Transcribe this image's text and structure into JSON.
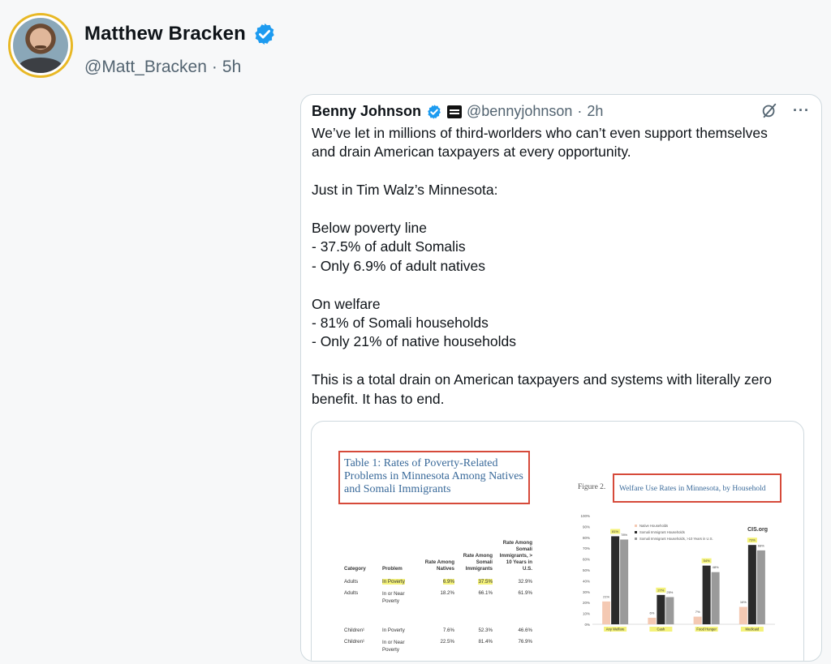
{
  "author": {
    "display_name": "Matthew Bracken",
    "handle": "@Matt_Bracken",
    "separator": "·",
    "time": "5h"
  },
  "quote": {
    "display_name": "Benny Johnson",
    "handle": "@bennyjohnson",
    "separator": "·",
    "time": "2h",
    "more": "···",
    "paragraphs": [
      [
        "We’ve let in millions of third-worlders who can’t even support themselves",
        "and drain American taxpayers at every opportunity."
      ],
      [
        "Just in Tim Walz’s Minnesota:"
      ],
      [
        "Below poverty line",
        "- 37.5% of adult Somalis",
        "- Only 6.9% of adult natives"
      ],
      [
        "On welfare",
        "- 81% of Somali households",
        "- Only 21% of native households"
      ],
      [
        "This is a total drain on American taxpayers and systems with literally zero",
        "benefit. It has to end."
      ]
    ]
  },
  "media": {
    "table_title": "Table 1: Rates of Poverty-Related Problems in Minnesota Among Natives and Somali Immigrants",
    "table": {
      "headers": [
        "Category",
        "Problem",
        "Rate Among Natives",
        "Rate Among Somali Immigrants",
        "Rate Among Somali Immigrants, > 10 Years in U.S."
      ],
      "rows": [
        [
          "Adults",
          "In Poverty",
          "6.9%",
          "37.5%",
          "32.9%"
        ],
        [
          "Adults",
          "In or Near Poverty",
          "18.2%",
          "66.1%",
          "61.9%"
        ],
        [
          "Children¹",
          "In Poverty",
          "7.6%",
          "52.3%",
          "46.6%"
        ],
        [
          "Children¹",
          "In or Near Poverty",
          "22.5%",
          "81.4%",
          "76.9%"
        ]
      ]
    },
    "figure_prefix": "Figure 2.",
    "figure_title": "Welfare Use Rates in Minnesota, by Household",
    "source_label": "CIS.org"
  },
  "chart_data": {
    "type": "bar",
    "title": "Welfare Use Rates in Minnesota, by Household",
    "categories": [
      "Any Welfare",
      "Cash",
      "Food Hunger",
      "Medicaid"
    ],
    "series": [
      {
        "name": "Native Households",
        "values": [
          21,
          6,
          7,
          16
        ],
        "color": "#f4c9b3"
      },
      {
        "name": "Somali Immigrant Households",
        "values": [
          81,
          27,
          54,
          73
        ],
        "color": "#2b2b2b"
      },
      {
        "name": "Somali Immigrant Households, >10 Years in U.S.",
        "values": [
          78,
          25,
          48,
          68
        ],
        "color": "#9a9a9a"
      }
    ],
    "yticks": [
      "0%",
      "10%",
      "20%",
      "30%",
      "40%",
      "50%",
      "60%",
      "70%",
      "80%",
      "90%",
      "100%"
    ],
    "ylim": [
      0,
      100
    ],
    "highlighted_labels": true,
    "legend_position": "top"
  },
  "colors": {
    "verified": "#1d9bf0",
    "avatar_ring": "#e8b825",
    "highlight": "#f4f27a",
    "box": "#d64a3a"
  }
}
